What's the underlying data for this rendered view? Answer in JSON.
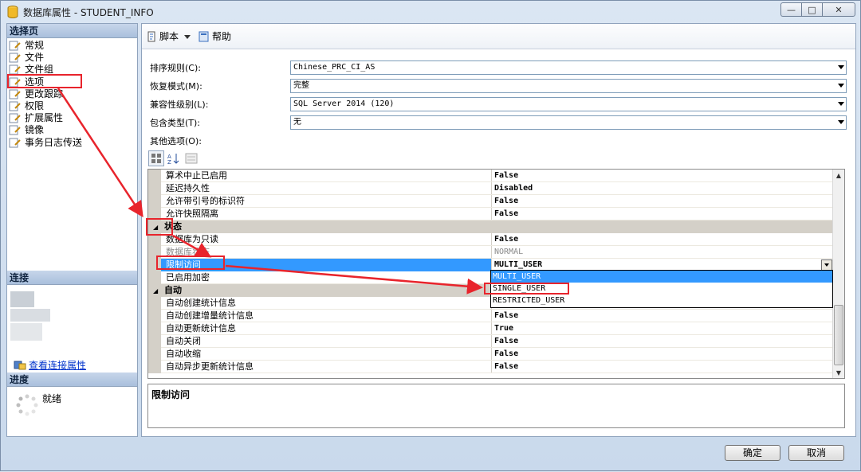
{
  "window": {
    "title": "数据库属性 - STUDENT_INFO",
    "controls": {
      "minimize": "—",
      "maximize": "□",
      "close": "✕"
    }
  },
  "left_pane": {
    "select_page_header": "选择页",
    "pages": [
      "常规",
      "文件",
      "文件组",
      "选项",
      "更改跟踪",
      "权限",
      "扩展属性",
      "镜像",
      "事务日志传送"
    ],
    "selected_page": "选项",
    "connection_header": "连接",
    "view_connection_properties": "查看连接属性",
    "progress_header": "进度",
    "progress_status": "就绪"
  },
  "toolbar": {
    "script": "脚本",
    "help": "帮助"
  },
  "fields": {
    "collation": {
      "label": "排序规则(C):",
      "value": "Chinese_PRC_CI_AS"
    },
    "recovery_model": {
      "label": "恢复模式(M):",
      "value": "完整"
    },
    "compatibility": {
      "label": "兼容性级别(L):",
      "value": "SQL Server 2014 (120)"
    },
    "containment": {
      "label": "包含类型(T):",
      "value": "无"
    },
    "other_options": {
      "label": "其他选项(O):"
    }
  },
  "grid": {
    "rows": [
      {
        "name": "算术中止已启用",
        "value": "False"
      },
      {
        "name": "延迟持久性",
        "value": "Disabled"
      },
      {
        "name": "允许带引号的标识符",
        "value": "False"
      },
      {
        "name": "允许快照隔离",
        "value": "False"
      }
    ],
    "status_category": "状态",
    "status_rows": [
      {
        "name": "数据库为只读",
        "value": "False"
      },
      {
        "name": "数据库状态",
        "value": "NORMAL"
      },
      {
        "name": "限制访问",
        "value": "MULTI_USER"
      },
      {
        "name": "已启用加密",
        "value": ""
      }
    ],
    "auto_category": "自动",
    "auto_rows": [
      {
        "name": "自动创建统计信息",
        "value": ""
      },
      {
        "name": "自动创建增量统计信息",
        "value": "False"
      },
      {
        "name": "自动更新统计信息",
        "value": "True"
      },
      {
        "name": "自动关闭",
        "value": "False"
      },
      {
        "name": "自动收缩",
        "value": "False"
      },
      {
        "name": "自动异步更新统计信息",
        "value": "False"
      }
    ],
    "dropdown_options": [
      "MULTI_USER",
      "SINGLE_USER",
      "RESTRICTED_USER"
    ]
  },
  "description": {
    "title": "限制访问"
  },
  "buttons": {
    "ok": "确定",
    "cancel": "取消"
  },
  "colors": {
    "annotation": "#e8242c",
    "selection": "#3399ff",
    "category": "#d4d0c8"
  }
}
